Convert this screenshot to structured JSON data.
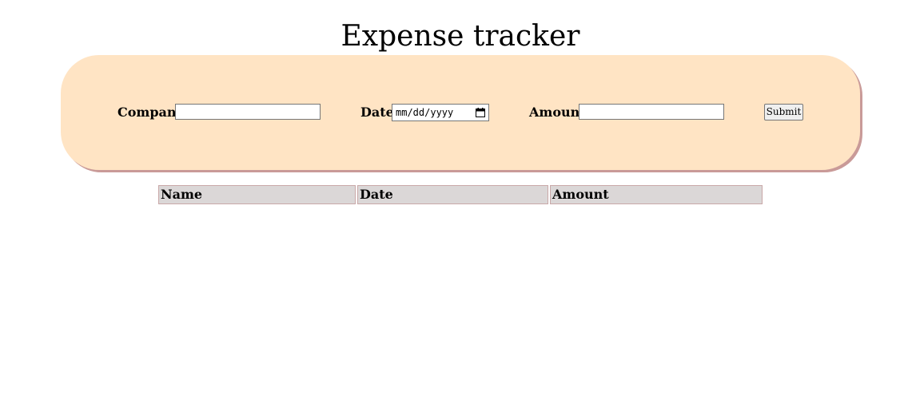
{
  "page": {
    "title": "Expense tracker"
  },
  "form": {
    "company_label": "Company",
    "company_value": "",
    "date_label": "Date:",
    "date_placeholder": "mm/dd/yyyy",
    "amount_label": "Amount",
    "amount_value": "",
    "submit_label": "Submit"
  },
  "table": {
    "headers": [
      "Name",
      "Date",
      "Amount"
    ]
  },
  "colors": {
    "panel_background": "#ffe4c4",
    "panel_shadow": "#c99a98",
    "header_cell_background": "#dbd7d7"
  },
  "icons": {
    "date_picker": "calendar-icon"
  }
}
